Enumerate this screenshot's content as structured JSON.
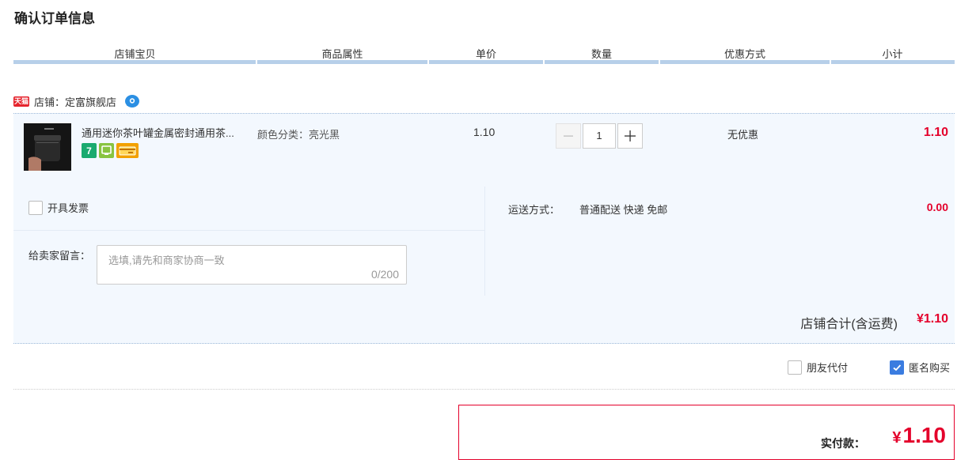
{
  "page_title": "确认订单信息",
  "columns": [
    "店铺宝贝",
    "商品属性",
    "单价",
    "数量",
    "优惠方式",
    "小计"
  ],
  "shop": {
    "badge": "天猫",
    "label": "店铺：",
    "name": "定富旗舰店"
  },
  "item": {
    "title": "通用迷你茶叶罐金属密封通用茶...",
    "badges": [
      {
        "icon": "seven-day-return-icon",
        "text": "7",
        "color": "#1aaa6f"
      },
      {
        "icon": "guarantee-icon",
        "text": "保",
        "color": "#88c441"
      },
      {
        "icon": "card-payment-icon",
        "text": "",
        "color": "#f2a100"
      }
    ],
    "attribute": "颜色分类：亮光黑",
    "unit_price": "1.10",
    "quantity": "1",
    "discount": "无优惠",
    "subtotal": "1.10"
  },
  "invoice_label": "开具发票",
  "message": {
    "label": "给卖家留言：",
    "placeholder": "选填,请先和商家协商一致",
    "counter": "0/200"
  },
  "shipping": {
    "label": "运送方式：",
    "method": "普通配送 快递 免邮",
    "price": "0.00"
  },
  "shop_total": {
    "label": "店铺合计(含运费)",
    "value": "¥1.10"
  },
  "options": {
    "friend_pay": "朋友代付",
    "friend_pay_checked": false,
    "anonymous_buy": "匿名购买",
    "anonymous_buy_checked": true
  },
  "payment": {
    "label": "实付款：",
    "currency": "¥",
    "amount": "1.10"
  },
  "colors": {
    "accent_red": "#e4002b",
    "header_line": "#b7cfe9",
    "row_bg": "#f3f8fe",
    "checkbox_blue": "#3a7ce0"
  }
}
